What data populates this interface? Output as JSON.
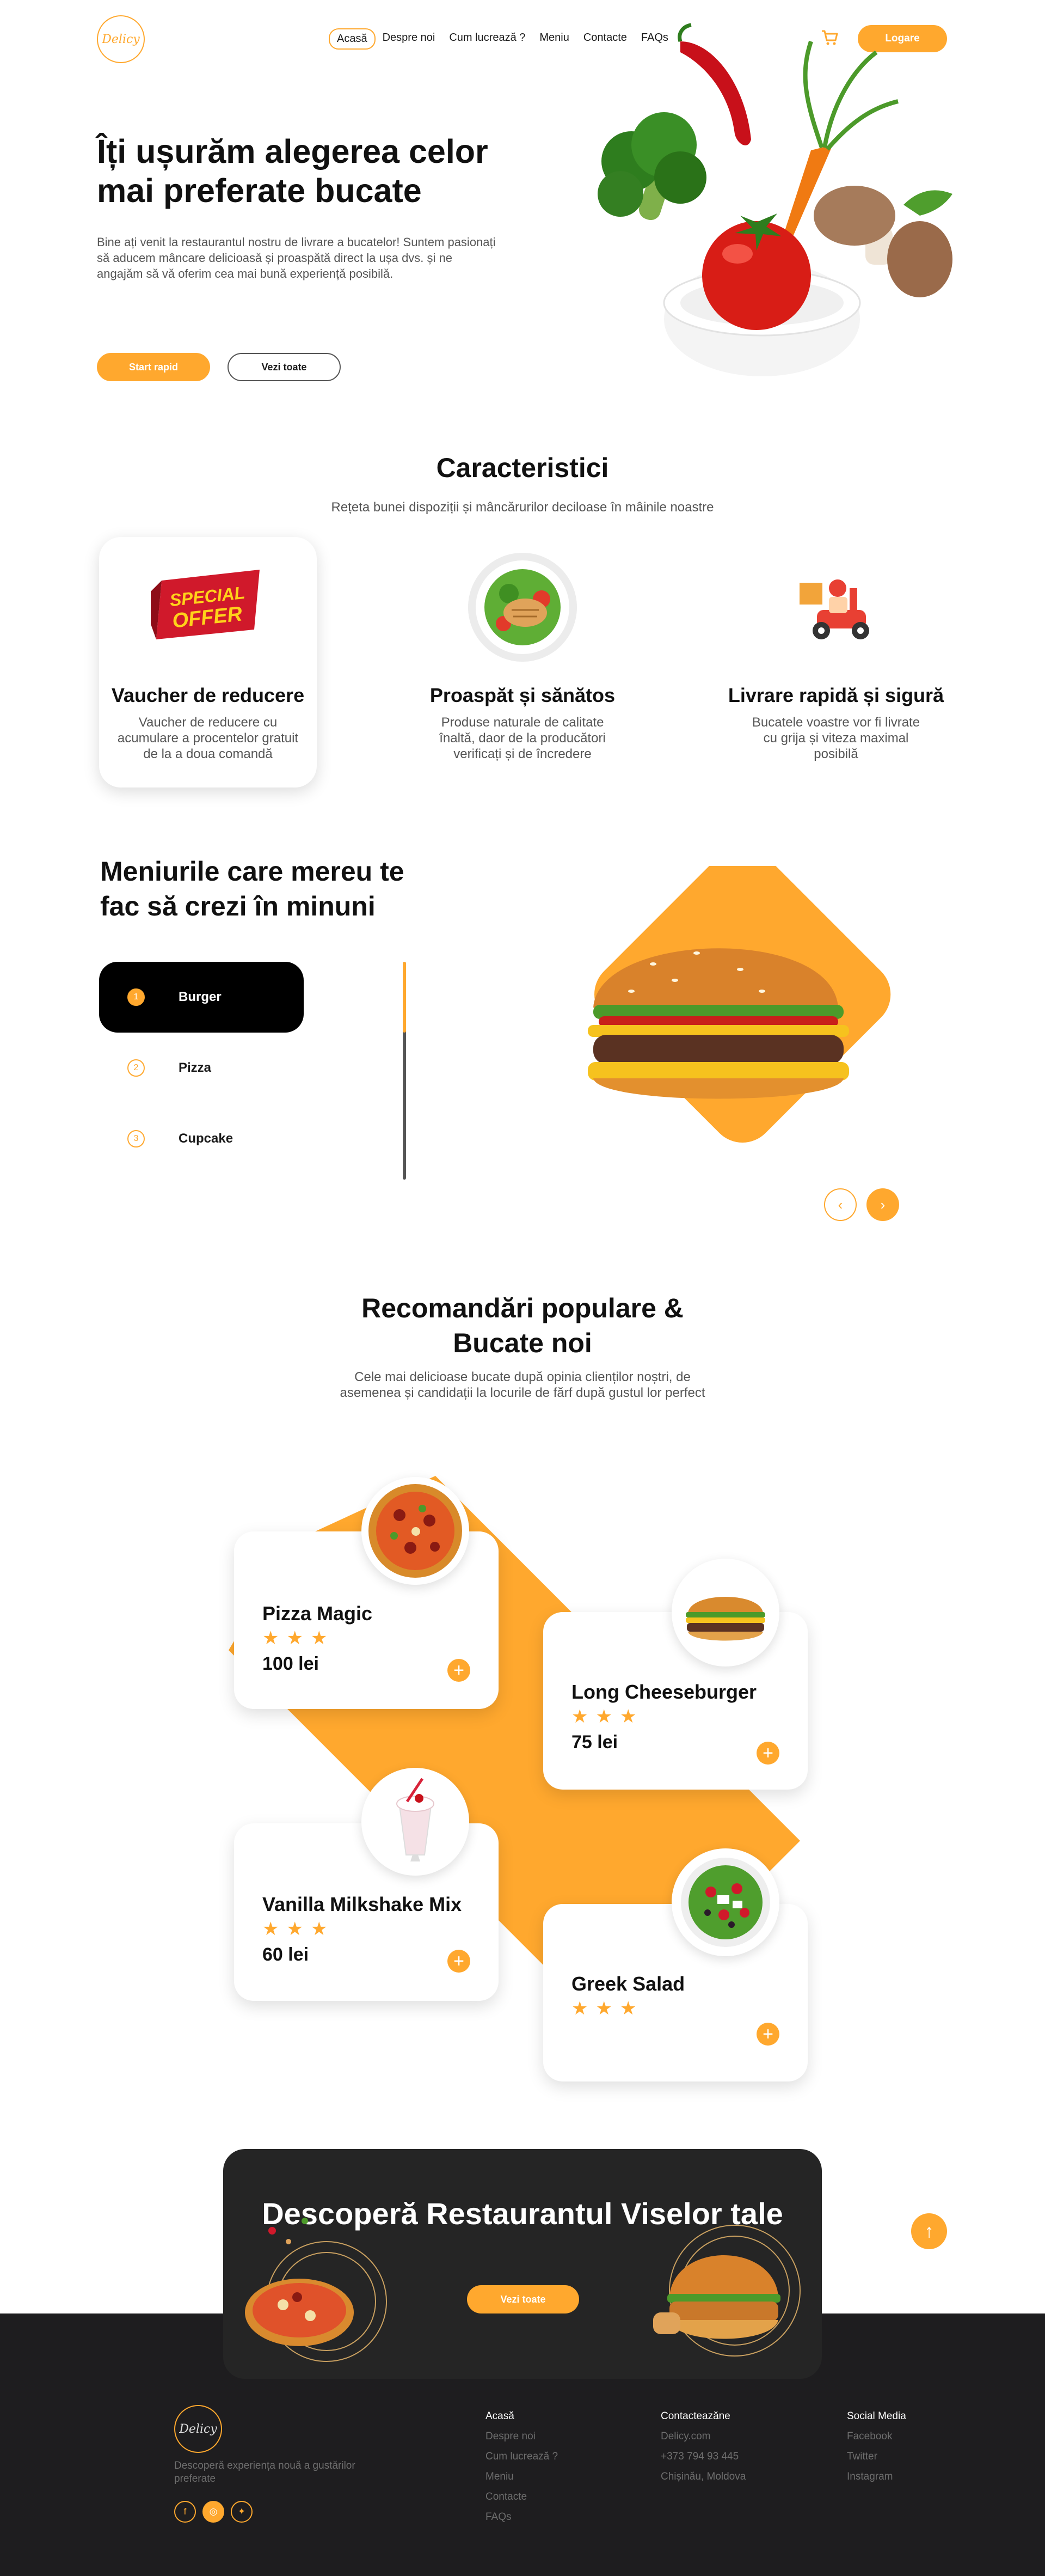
{
  "brand": {
    "logo_text": "Delicy",
    "accent": "#FFA82E",
    "dark": "#1e1d1f"
  },
  "nav": {
    "items": [
      "Acasă",
      "Despre noi",
      "Cum lucrează ?",
      "Meniu",
      "Contacte",
      "FAQs"
    ],
    "active_index": 0,
    "cart_icon": "cart-icon",
    "login_label": "Logare"
  },
  "hero": {
    "title": "Îți ușurăm alegerea celor mai preferate bucate",
    "text": "Bine ați venit la restaurantul nostru de livrare a bucatelor! Suntem pasionați să aducem mâncare delicioasă și proaspătă direct la ușa dvs. și ne angajăm să vă oferim cea mai bună experiență posibilă.",
    "btn_start": "Start rapid",
    "btn_all": "Vezi toate"
  },
  "features": {
    "title": "Caracteristici",
    "subtitle": "Rețeta bunei dispoziții și mâncărurilor deciloase în mâinile noastre",
    "items": [
      {
        "title": "Vaucher de reducere",
        "text": "Vaucher de reducere cu acumulare a procentelor gratuit de la a doua comandă",
        "badge_line1": "SPECIAL",
        "badge_line2": "OFFER"
      },
      {
        "title": "Proaspăt și sănătos",
        "text": "Produse naturale de calitate înaltă, daor de la producători verificați și de încredere"
      },
      {
        "title": "Livrare rapidă și sigură",
        "text": "Bucatele voastre vor fi livrate cu grija și viteza maximal posibilă"
      }
    ]
  },
  "menu": {
    "title": "Meniurile care mereu te fac să crezi în minuni",
    "items": [
      {
        "num": "1",
        "label": "Burger"
      },
      {
        "num": "2",
        "label": "Pizza"
      },
      {
        "num": "3",
        "label": "Cupcake"
      }
    ],
    "active_index": 0,
    "prev_icon": "chevron-left-icon",
    "next_icon": "chevron-right-icon"
  },
  "popular": {
    "title": "Recomandări populare & Bucate noi",
    "subtitle": "Cele mai delicioase bucate după opinia clienților noștri, de asemenea și candidații la locurile de fărf după gustul lor perfect",
    "items": [
      {
        "name": "Pizza Magic",
        "rating": 3,
        "stars": "★★★",
        "price": "100 lei"
      },
      {
        "name": "Long Cheeseburger",
        "rating": 3,
        "stars": "★★★",
        "price": "75 lei"
      },
      {
        "name": "Vanilla Milkshake Mix",
        "rating": 3,
        "stars": "★★★",
        "price": "60 lei"
      },
      {
        "name": "Greek Salad",
        "rating": 3,
        "stars": "★★★",
        "price": ""
      }
    ]
  },
  "cta": {
    "title": "Descoperă Restaurantul Viselor tale",
    "button": "Vezi toate",
    "to_top_icon": "arrow-up-icon"
  },
  "footer": {
    "logo_text": "Delicy",
    "tagline": "Descoperă experiența nouă a gustărilor preferate",
    "social_icons": [
      "facebook-icon",
      "instagram-icon",
      "twitter-icon"
    ],
    "columns": [
      {
        "head": "Acasă",
        "links": [
          "Despre noi",
          "Cum lucrează ?",
          "Meniu",
          "Contacte",
          "FAQs"
        ]
      },
      {
        "head": "Contacteazăne",
        "links": [
          "Delicy.com",
          "+373 794 93 445",
          "Chișinău, Moldova"
        ]
      },
      {
        "head": "Social Media",
        "links": [
          "Facebook",
          "Twitter",
          "Instagram"
        ]
      }
    ]
  }
}
